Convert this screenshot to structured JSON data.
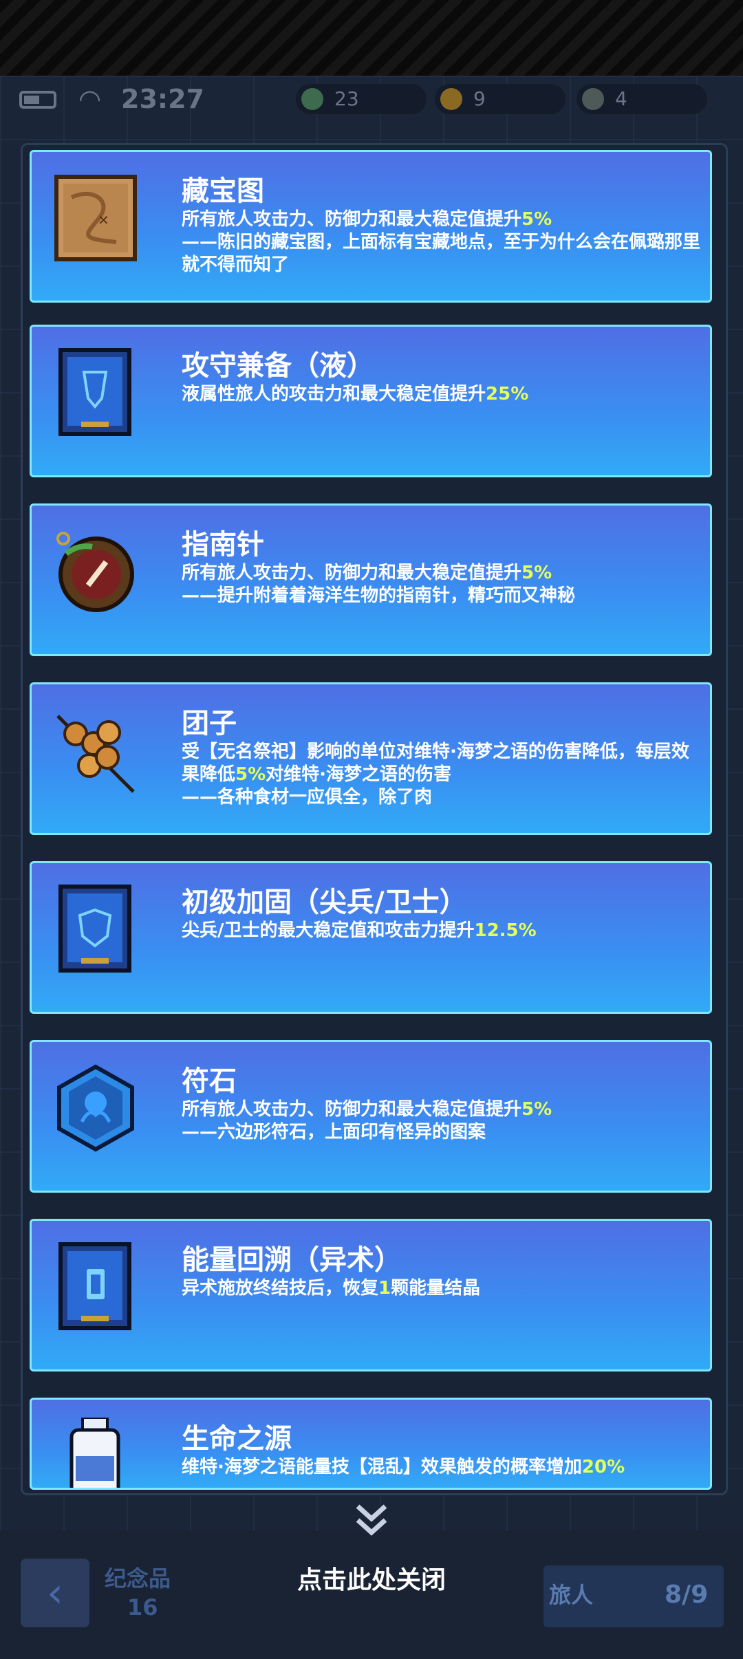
{
  "status_bar": {
    "time": "23:27",
    "battery_icon": "battery-icon",
    "wifi_icon": "wifi-icon"
  },
  "resources": [
    {
      "name": "green-coin",
      "value": "23",
      "color": "#3e6b4e"
    },
    {
      "name": "gold-coin",
      "value": "9",
      "color": "#8a6a22"
    },
    {
      "name": "grey-coin",
      "value": "4",
      "color": "#4d5a58"
    }
  ],
  "cards": [
    {
      "icon": "treasure-map-icon",
      "title": "藏宝图",
      "desc_parts": [
        {
          "t": "所有旅人攻击力、防御力和最大稳定值提升"
        },
        {
          "t": "5%",
          "hl": true
        },
        {
          "t": "\n——陈旧的藏宝图，上面标有宝藏地点，至于为什么会在佩璐那里就不得而知了"
        }
      ]
    },
    {
      "icon": "blue-card-liquid-icon",
      "title": "攻守兼备（液）",
      "desc_parts": [
        {
          "t": "液属性旅人的攻击力和最大稳定值提升"
        },
        {
          "t": "25%",
          "hl": true
        }
      ]
    },
    {
      "icon": "compass-icon",
      "title": "指南针",
      "desc_parts": [
        {
          "t": "所有旅人攻击力、防御力和最大稳定值提升"
        },
        {
          "t": "5%",
          "hl": true
        },
        {
          "t": "\n——提升附着着海洋生物的指南针，精巧而又神秘"
        }
      ]
    },
    {
      "icon": "dango-icon",
      "title": "团子",
      "desc_parts": [
        {
          "t": "受【无名祭祀】影响的单位对维特·海梦之语的伤害降低，每层效果降低"
        },
        {
          "t": "5%",
          "hl": true
        },
        {
          "t": "对维特·海梦之语的伤害\n——各种食材一应俱全，除了肉"
        }
      ]
    },
    {
      "icon": "blue-card-shield-icon",
      "title": "初级加固（尖兵/卫士）",
      "desc_parts": [
        {
          "t": "尖兵/卫士的最大稳定值和攻击力提升"
        },
        {
          "t": "12.5%",
          "hl": true
        }
      ]
    },
    {
      "icon": "rune-stone-icon",
      "title": "符石",
      "desc_parts": [
        {
          "t": "所有旅人攻击力、防御力和最大稳定值提升"
        },
        {
          "t": "5%",
          "hl": true
        },
        {
          "t": "\n——六边形符石，上面印有怪异的图案"
        }
      ]
    },
    {
      "icon": "blue-card-energy-icon",
      "title": "能量回溯（异术）",
      "desc_parts": [
        {
          "t": "异术施放终结技后，恢复"
        },
        {
          "t": "1",
          "hl": true
        },
        {
          "t": "颗能量结晶"
        }
      ]
    },
    {
      "icon": "water-bottle-icon",
      "title": "生命之源",
      "desc_parts": [
        {
          "t": "维特·海梦之语能量技【混乱】效果触发的概率增加"
        },
        {
          "t": "20%",
          "hl": true
        }
      ]
    }
  ],
  "bottom": {
    "souvenir_label": "纪念品",
    "souvenir_count": "16",
    "traveler_label": "旅人",
    "traveler_count": "8/9",
    "close_hint": "点击此处关闭"
  }
}
